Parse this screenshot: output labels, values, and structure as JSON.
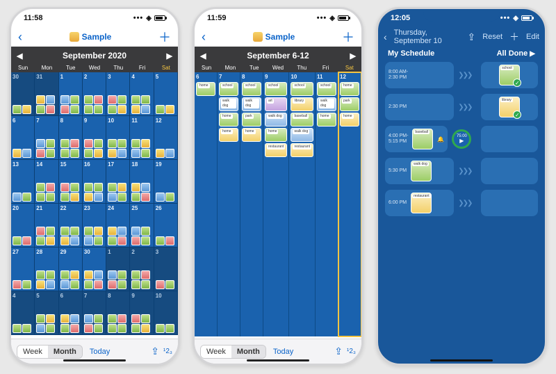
{
  "colors": {
    "ios_blue": "#0a63c9",
    "bg_blue": "#1a62ae",
    "dark_blue": "#19579a",
    "accent_yellow": "#f5c542",
    "timer_green": "#2fa84f"
  },
  "phone1": {
    "status_time": "11:58",
    "title": "Sample",
    "cal_title": "September 2020",
    "dow": [
      "Sun",
      "Mon",
      "Tue",
      "Wed",
      "Thu",
      "Fri",
      "Sat"
    ],
    "cells": [
      {
        "n": "30",
        "t": "prev"
      },
      {
        "n": "31",
        "t": "prev"
      },
      {
        "n": "1",
        "t": "cur"
      },
      {
        "n": "2",
        "t": "cur"
      },
      {
        "n": "3",
        "t": "cur"
      },
      {
        "n": "4",
        "t": "cur"
      },
      {
        "n": "5",
        "t": "cur"
      },
      {
        "n": "6",
        "t": "cur"
      },
      {
        "n": "7",
        "t": "cur"
      },
      {
        "n": "8",
        "t": "cur"
      },
      {
        "n": "9",
        "t": "cur"
      },
      {
        "n": "10",
        "t": "cur"
      },
      {
        "n": "11",
        "t": "cur"
      },
      {
        "n": "12",
        "t": "cur"
      },
      {
        "n": "13",
        "t": "cur"
      },
      {
        "n": "14",
        "t": "cur"
      },
      {
        "n": "15",
        "t": "cur"
      },
      {
        "n": "16",
        "t": "cur"
      },
      {
        "n": "17",
        "t": "cur"
      },
      {
        "n": "18",
        "t": "cur"
      },
      {
        "n": "19",
        "t": "cur"
      },
      {
        "n": "20",
        "t": "cur"
      },
      {
        "n": "21",
        "t": "cur"
      },
      {
        "n": "22",
        "t": "cur"
      },
      {
        "n": "23",
        "t": "cur"
      },
      {
        "n": "24",
        "t": "cur"
      },
      {
        "n": "25",
        "t": "cur"
      },
      {
        "n": "26",
        "t": "cur"
      },
      {
        "n": "27",
        "t": "cur"
      },
      {
        "n": "28",
        "t": "cur"
      },
      {
        "n": "29",
        "t": "cur"
      },
      {
        "n": "30",
        "t": "cur"
      },
      {
        "n": "1",
        "t": "next"
      },
      {
        "n": "2",
        "t": "next"
      },
      {
        "n": "3",
        "t": "next"
      },
      {
        "n": "4",
        "t": "next"
      },
      {
        "n": "5",
        "t": "next"
      },
      {
        "n": "6",
        "t": "next"
      },
      {
        "n": "7",
        "t": "next"
      },
      {
        "n": "8",
        "t": "next"
      },
      {
        "n": "9",
        "t": "next"
      },
      {
        "n": "10",
        "t": "next"
      }
    ],
    "seg": {
      "week": "Week",
      "month": "Month",
      "active": "Month"
    },
    "today": "Today",
    "counter": "¹2₃"
  },
  "phone2": {
    "status_time": "11:59",
    "title": "Sample",
    "cal_title": "September 6-12",
    "dow": [
      "Sun",
      "Mon",
      "Tue",
      "Wed",
      "Thu",
      "Fri",
      "Sat"
    ],
    "highlight_day_index": 6,
    "columns": [
      {
        "n": "6",
        "items": [
          {
            "l": "home",
            "c": ""
          }
        ]
      },
      {
        "n": "7",
        "items": [
          {
            "l": "school",
            "c": ""
          },
          {
            "l": "walk dog",
            "c": "b"
          },
          {
            "l": "home",
            "c": ""
          },
          {
            "l": "home",
            "c": "y"
          }
        ]
      },
      {
        "n": "8",
        "items": [
          {
            "l": "school",
            "c": ""
          },
          {
            "l": "walk dog",
            "c": "b"
          },
          {
            "l": "park",
            "c": ""
          },
          {
            "l": "home",
            "c": "y"
          }
        ]
      },
      {
        "n": "9",
        "items": [
          {
            "l": "school",
            "c": ""
          },
          {
            "l": "art",
            "c": "p"
          },
          {
            "l": "walk dog",
            "c": "b"
          },
          {
            "l": "home",
            "c": ""
          },
          {
            "l": "restaurant",
            "c": "y"
          }
        ]
      },
      {
        "n": "10",
        "items": [
          {
            "l": "school",
            "c": ""
          },
          {
            "l": "library",
            "c": "y"
          },
          {
            "l": "baseball",
            "c": ""
          },
          {
            "l": "walk dog",
            "c": "b"
          },
          {
            "l": "restaurant",
            "c": "y"
          }
        ]
      },
      {
        "n": "11",
        "items": [
          {
            "l": "school",
            "c": ""
          },
          {
            "l": "walk dog",
            "c": "b"
          },
          {
            "l": "home",
            "c": ""
          }
        ]
      },
      {
        "n": "12",
        "items": [
          {
            "l": "home",
            "c": ""
          },
          {
            "l": "park",
            "c": ""
          },
          {
            "l": "home",
            "c": "y"
          }
        ]
      }
    ],
    "seg": {
      "week": "Week",
      "month": "Month",
      "active": "Month"
    },
    "today": "Today",
    "counter": "¹2₃"
  },
  "phone3": {
    "status_time": "12:05",
    "title": "Thursday, September 10",
    "reset": "Reset",
    "edit": "Edit",
    "head_left": "My Schedule",
    "head_right": "All Done",
    "timer_value": "75:00",
    "left_rows": [
      {
        "time": "8:00 AM-\n2:30 PM",
        "pic": null,
        "bell": false
      },
      {
        "time": "2:30 PM",
        "pic": null,
        "bell": false
      },
      {
        "time": "4:00 PM-\n5:15 PM",
        "pic": {
          "l": "baseball",
          "c": ""
        },
        "bell": true,
        "timer": true
      },
      {
        "time": "5:30 PM",
        "pic": {
          "l": "walk dog",
          "c": "b"
        },
        "bell": false
      },
      {
        "time": "6:00 PM",
        "pic": {
          "l": "restaurant",
          "c": "y"
        },
        "bell": false
      }
    ],
    "right_rows": [
      {
        "pic": {
          "l": "school",
          "c": ""
        },
        "check": true
      },
      {
        "pic": {
          "l": "library",
          "c": "y"
        },
        "check": true
      },
      {
        "pic": null
      },
      {
        "pic": null
      },
      {
        "pic": null
      }
    ]
  }
}
